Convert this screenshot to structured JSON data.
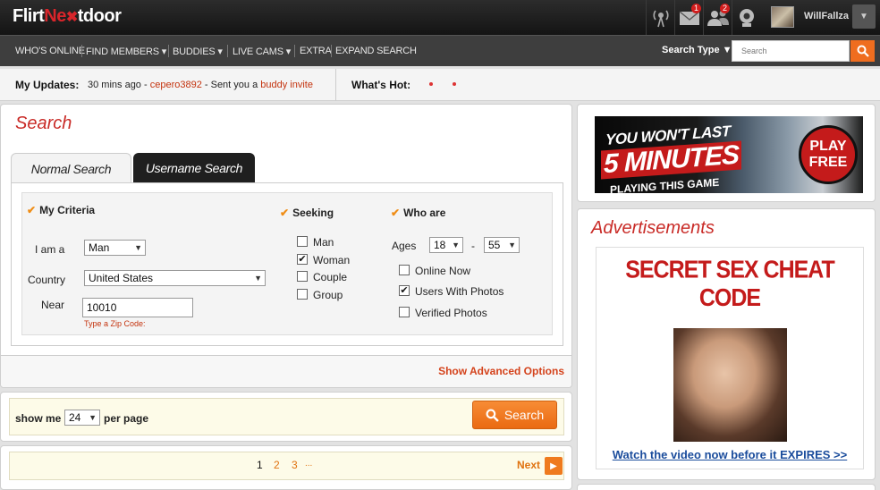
{
  "brand": {
    "logo": "FlirtNextdoor",
    "logo_a": "Flirt",
    "logo_b": "Ne",
    "logo_c": "tdoor"
  },
  "topbar": {
    "icons": [
      {
        "name": "signal-icon",
        "badge": ""
      },
      {
        "name": "mail-icon",
        "badge": "1"
      },
      {
        "name": "friends-icon",
        "badge": "2"
      },
      {
        "name": "webcam-icon",
        "badge": ""
      }
    ],
    "username": "WillFallza"
  },
  "nav": {
    "items": [
      "WHO'S ONLINE",
      "FIND MEMBERS ▾",
      "BUDDIES ▾",
      "LIVE CAMS ▾",
      "EXTRA",
      "EXPAND SEARCH"
    ],
    "search_type": "Search Type ▼",
    "search_placeholder": "Search"
  },
  "updates": {
    "label": "My Updates:",
    "time": "30 mins ago",
    "dash": " - ",
    "user": "cepero3892",
    "middle": " - Sent you a ",
    "link": "buddy invite",
    "hot_label": "What's Hot:"
  },
  "search": {
    "title": "Search",
    "tabs": {
      "normal": "Normal Search",
      "username": "Username Search"
    },
    "my_criteria": "My Criteria",
    "seeking_title": "Seeking",
    "who_are": "Who are",
    "i_am_label": "I am a",
    "i_am_value": "Man",
    "country_label": "Country",
    "country_value": "United States",
    "near_label": "Near",
    "near_value": "10010",
    "zip_hint": "Type a Zip Code:",
    "seeking": [
      {
        "label": "Man",
        "checked": false
      },
      {
        "label": "Woman",
        "checked": true
      },
      {
        "label": "Couple",
        "checked": false
      },
      {
        "label": "Group",
        "checked": false
      }
    ],
    "ages_label": "Ages",
    "age_min": "18",
    "age_dash": "-",
    "age_max": "55",
    "who_options": [
      {
        "label": "Online Now",
        "checked": false
      },
      {
        "label": "Users With Photos",
        "checked": true
      },
      {
        "label": "Verified Photos",
        "checked": false
      }
    ],
    "advanced_link": "Show Advanced Options"
  },
  "results": {
    "show_me": "show me",
    "per_page_value": "24",
    "per_page": "per page",
    "search_button": "Search"
  },
  "pagination": {
    "pages": [
      "1",
      "2",
      "3"
    ],
    "ellipsis": "...",
    "next": "Next"
  },
  "ads": {
    "banner_line1": "YOU WON'T LAST",
    "banner_line2": "5 MINUTES",
    "banner_line3": "PLAYING THIS GAME",
    "banner_cta": "PLAY FREE",
    "title": "Advertisements",
    "headline": "SECRET SEX CHEAT CODE",
    "link": "Watch the video now before it EXPIRES >>"
  },
  "colors": {
    "accent": "#c92b27",
    "orange": "#ef6d1f",
    "link": "#1a4c9c"
  }
}
